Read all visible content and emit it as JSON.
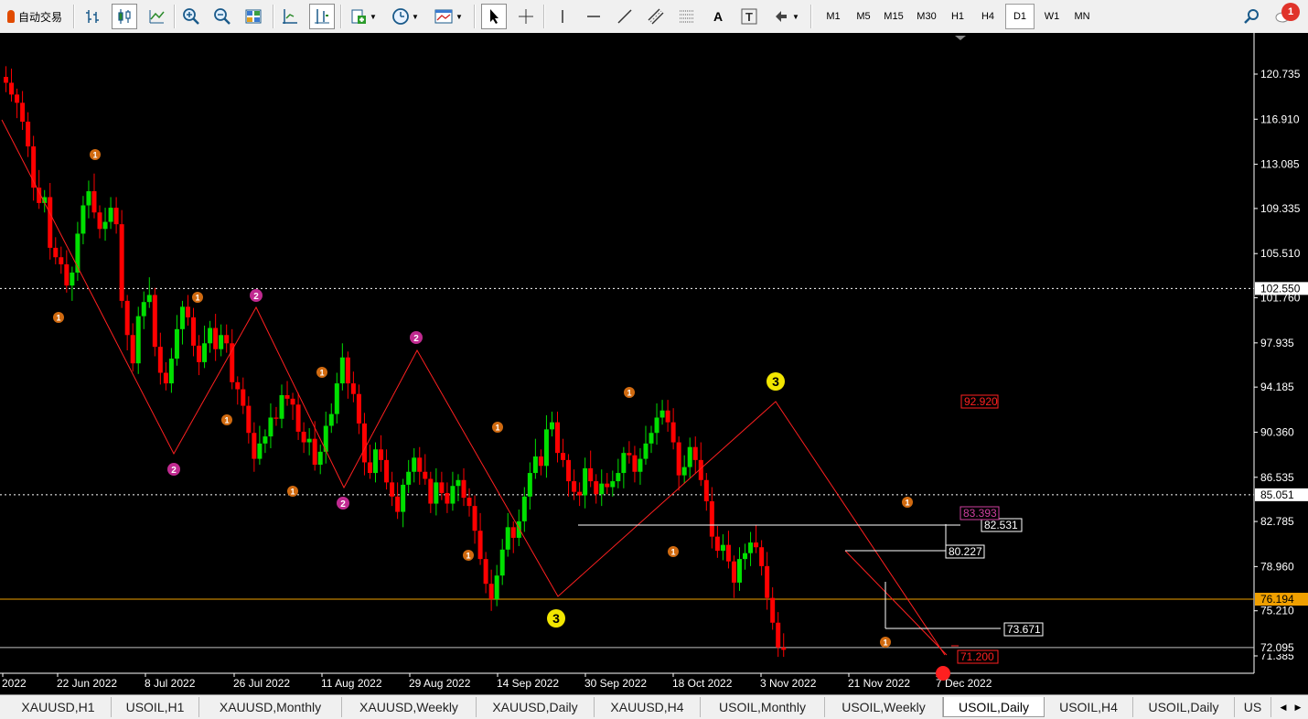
{
  "toolbar": {
    "auto_trade_label": "自动交易",
    "timeframes": [
      "M1",
      "M5",
      "M15",
      "M30",
      "H1",
      "H4",
      "D1",
      "W1",
      "MN"
    ],
    "active_timeframe": "D1",
    "notification_count": "1"
  },
  "chart": {
    "symbol_period": "USOIL,Daily",
    "price_axis_labels": [
      "120.735",
      "116.910",
      "113.085",
      "109.335",
      "105.510",
      "101.760",
      "97.935",
      "94.185",
      "90.360",
      "86.535",
      "82.785",
      "78.960",
      "75.210",
      "71.385"
    ],
    "date_axis_labels": [
      "2022",
      "22 Jun 2022",
      "8 Jul 2022",
      "26 Jul 2022",
      "11 Aug 2022",
      "29 Aug 2022",
      "14 Sep 2022",
      "30 Sep 2022",
      "18 Oct 2022",
      "3 Nov 2022",
      "21 Nov 2022",
      "7 Dec 2022"
    ],
    "horizontal_lines": [
      {
        "price": "102.550",
        "style": "dotted",
        "color": "#ffffff"
      },
      {
        "price": "85.051",
        "style": "dotted",
        "color": "#ffffff"
      },
      {
        "price": "76.194",
        "style": "solid",
        "color": "#f0a000"
      },
      {
        "price": "72.095",
        "style": "solid",
        "color": "#c0c0c0"
      }
    ],
    "level_labels": [
      {
        "text": "92.920",
        "color": "#ff2020"
      },
      {
        "text": "82.531",
        "color": "#ffffff"
      },
      {
        "text": "80.227",
        "color": "#ffffff"
      },
      {
        "text": "73.671",
        "color": "#ffffff"
      },
      {
        "text": "71.200",
        "color": "#ff2020"
      },
      {
        "text": "83.393",
        "color": "#d040a0"
      }
    ],
    "wave_markers": [
      {
        "text": "1",
        "color": "#d06a10",
        "kind": "minor"
      },
      {
        "text": "2",
        "color": "#c02a90",
        "kind": "minor"
      },
      {
        "text": "3",
        "color": "#f2e600",
        "kind": "major"
      }
    ],
    "colors": {
      "bull": "#00e000",
      "bear": "#ff0000",
      "zigzag": "#ff2020",
      "background": "#000000",
      "axis_text": "#ffffff"
    }
  },
  "tabs": [
    "XAUUSD,H1",
    "USOIL,H1",
    "XAUUSD,Monthly",
    "XAUUSD,Weekly",
    "XAUUSD,Daily",
    "XAUUSD,H4",
    "USOIL,Monthly",
    "USOIL,Weekly",
    "USOIL,Daily",
    "USOIL,H4",
    "USOIL,Daily",
    "US"
  ],
  "active_tab_index": 8
}
